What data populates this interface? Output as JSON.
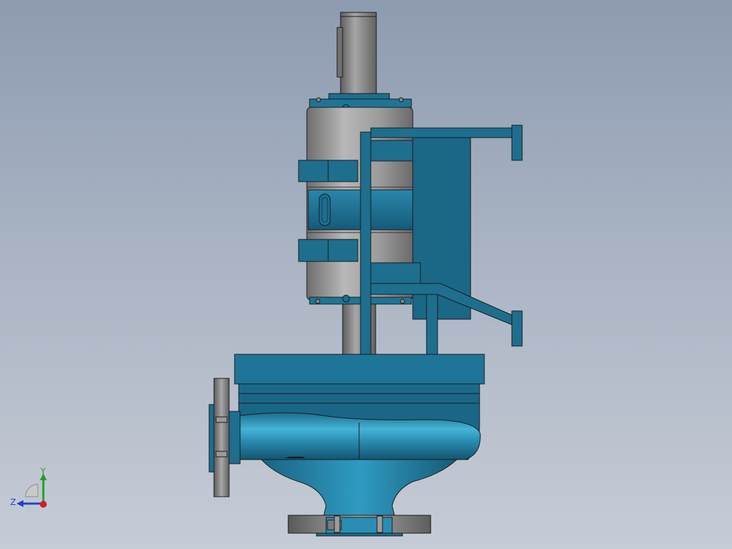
{
  "viewport": {
    "background_top": "#8d9bb1",
    "background_bottom": "#c6ccd6"
  },
  "colors": {
    "pump_blue": "#1e6e8e",
    "pump_blue_dark": "#124e68",
    "pump_blue_light": "#3aa6c8",
    "motor_gray": "#8a8a8a",
    "motor_gray_light": "#b4b4b4",
    "edge": "#1a1a1a"
  },
  "triad": {
    "y_label": "Y",
    "z_label": "Z",
    "y_color": "#1f9e2a",
    "z_color": "#1f3fd0",
    "x_color": "#d01f1f"
  }
}
